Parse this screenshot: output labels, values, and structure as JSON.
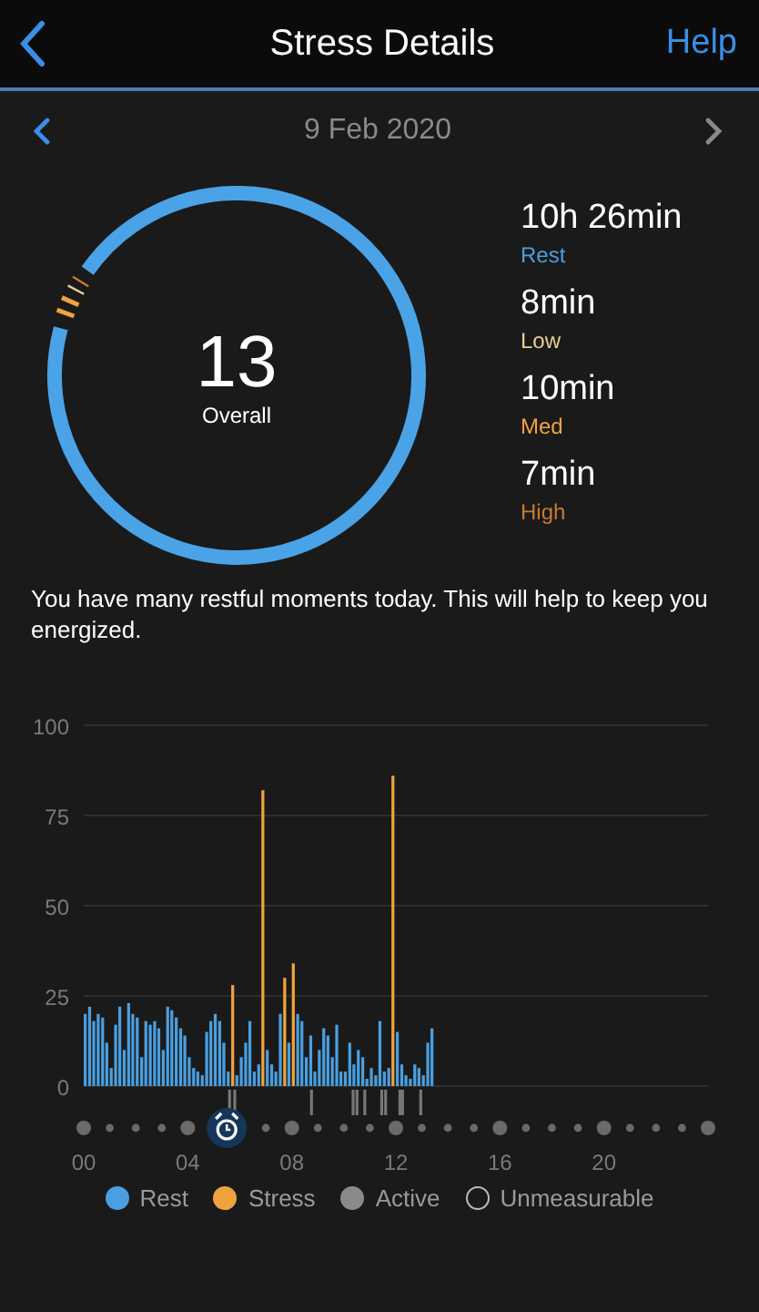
{
  "header": {
    "title": "Stress Details",
    "help": "Help"
  },
  "date_nav": {
    "date": "9 Feb 2020"
  },
  "overall": {
    "score": "13",
    "label": "Overall"
  },
  "summary": [
    {
      "value": "10h 26min",
      "label": "Rest",
      "color": "#4a9fe0"
    },
    {
      "value": "8min",
      "label": "Low",
      "color": "#e9cf96"
    },
    {
      "value": "10min",
      "label": "Med",
      "color": "#f0a33c"
    },
    {
      "value": "7min",
      "label": "High",
      "color": "#c97a30"
    }
  ],
  "message": "You have many restful moments today. This will help to keep you energized.",
  "chart": {
    "chart_data": {
      "type": "bar",
      "grid": true,
      "xlim": [
        0,
        24
      ],
      "ylim": [
        0,
        100
      ],
      "x": [
        0,
        0.17,
        0.33,
        0.5,
        0.67,
        0.83,
        1,
        1.17,
        1.33,
        1.5,
        1.67,
        1.83,
        2,
        2.17,
        2.33,
        2.5,
        2.67,
        2.83,
        3,
        3.17,
        3.33,
        3.5,
        3.67,
        3.83,
        4,
        4.17,
        4.33,
        4.5,
        4.67,
        4.83,
        5,
        5.17,
        5.33,
        5.5,
        5.67,
        5.83,
        6,
        6.17,
        6.33,
        6.5,
        6.67,
        6.83,
        7,
        7.17,
        7.33,
        7.5,
        7.67,
        7.83,
        8,
        8.17,
        8.33,
        8.5,
        8.67,
        8.83,
        9,
        9.17,
        9.33,
        9.5,
        9.67,
        9.83,
        10,
        10.17,
        10.33,
        10.5,
        10.67,
        10.83,
        11,
        11.17,
        11.33,
        11.5,
        11.67,
        11.83,
        12,
        12.17,
        12.33,
        12.5,
        12.67,
        12.83,
        13,
        13.17,
        13.33
      ],
      "yticks": [
        0,
        25,
        50,
        75,
        100
      ],
      "xticks": [
        {
          "value": 0,
          "label": "00"
        },
        {
          "value": 4,
          "label": "04"
        },
        {
          "value": 8,
          "label": "08"
        },
        {
          "value": 12,
          "label": "12"
        },
        {
          "value": 16,
          "label": "16"
        },
        {
          "value": 20,
          "label": "20"
        }
      ],
      "series": [
        {
          "name": "Rest",
          "color": "#4a9fe0",
          "values": [
            20,
            22,
            18,
            20,
            19,
            12,
            5,
            17,
            22,
            10,
            23,
            20,
            19,
            8,
            18,
            17,
            18,
            16,
            10,
            22,
            21,
            19,
            16,
            14,
            8,
            5,
            4,
            3,
            15,
            18,
            20,
            18,
            12,
            4,
            null,
            3,
            8,
            12,
            18,
            4,
            6,
            null,
            10,
            6,
            4,
            20,
            null,
            12,
            null,
            20,
            18,
            8,
            14,
            4,
            10,
            16,
            14,
            8,
            17,
            4,
            4,
            12,
            6,
            10,
            8,
            2,
            5,
            3,
            18,
            4,
            5,
            null,
            15,
            6,
            3,
            2,
            6,
            5,
            3,
            12,
            16
          ]
        },
        {
          "name": "Stress",
          "color": "#f0a33c",
          "values": [
            null,
            null,
            null,
            null,
            null,
            null,
            null,
            null,
            null,
            null,
            null,
            null,
            null,
            null,
            null,
            null,
            null,
            null,
            null,
            null,
            null,
            null,
            null,
            null,
            null,
            null,
            null,
            null,
            null,
            null,
            null,
            null,
            null,
            null,
            28,
            null,
            null,
            null,
            null,
            null,
            null,
            82,
            null,
            null,
            null,
            null,
            30,
            null,
            34,
            null,
            null,
            null,
            null,
            null,
            null,
            null,
            null,
            null,
            null,
            null,
            null,
            null,
            null,
            null,
            null,
            null,
            null,
            null,
            null,
            null,
            null,
            86,
            null,
            null,
            null,
            null,
            null,
            null,
            null,
            null,
            null
          ]
        }
      ]
    }
  },
  "legend": [
    {
      "label": "Active",
      "color": "#8a8a8a",
      "kind": "filled"
    },
    {
      "label": "Unmeasurable",
      "color": "#bbbbbb",
      "kind": "outline"
    }
  ]
}
